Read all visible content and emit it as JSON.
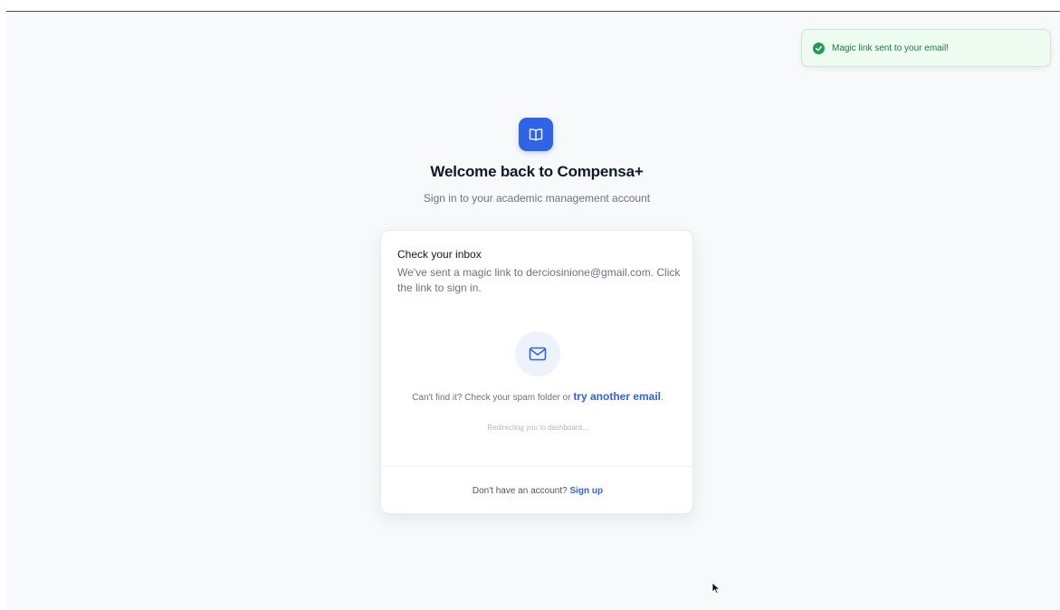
{
  "toast": {
    "message": "Magic link sent to your email!",
    "icon": "check-circle-icon",
    "color": "#1f9d55"
  },
  "brand": {
    "logo_icon": "book-open-icon",
    "accent": "#2f63e8"
  },
  "header": {
    "title": "Welcome back to Compensa+",
    "subtitle": "Sign in to your academic management account"
  },
  "card": {
    "title": "Check your inbox",
    "description": "We've sent a magic link to derciosinione@gmail.com. Click the link to sign in.",
    "mail_icon": "mail-icon",
    "spam_text": "Can't find it? Check your spam folder or ",
    "spam_link": "try another email",
    "spam_suffix": ".",
    "redirect_text": "Redirecting you to dashboard...",
    "footer_text": "Don't have an account? ",
    "signup_link": "Sign up"
  }
}
